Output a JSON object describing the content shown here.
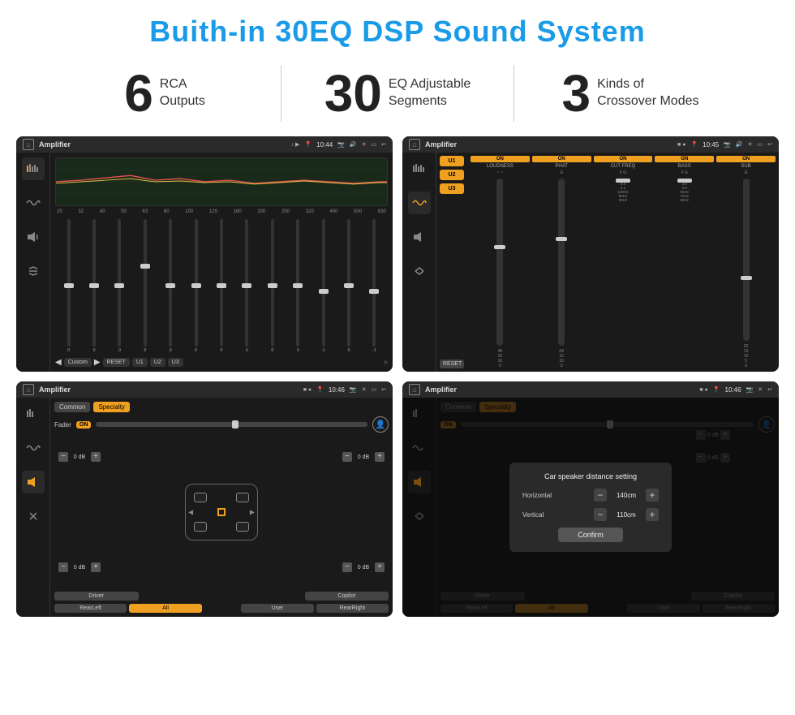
{
  "page": {
    "title": "Buith-in 30EQ DSP Sound System"
  },
  "stats": [
    {
      "number": "6",
      "label": "RCA\nOutputs"
    },
    {
      "number": "30",
      "label": "EQ Adjustable\nSegments"
    },
    {
      "number": "3",
      "label": "Kinds of\nCrossover Modes"
    }
  ],
  "screens": [
    {
      "id": "screen1",
      "title": "Amplifier",
      "time": "10:44",
      "type": "eq"
    },
    {
      "id": "screen2",
      "title": "Amplifier",
      "time": "10:45",
      "type": "crossover"
    },
    {
      "id": "screen3",
      "title": "Amplifier",
      "time": "10:46",
      "type": "fader"
    },
    {
      "id": "screen4",
      "title": "Amplifier",
      "time": "10:46",
      "type": "distance"
    }
  ],
  "eq": {
    "freq_labels": [
      "25",
      "32",
      "40",
      "50",
      "63",
      "80",
      "100",
      "125",
      "160",
      "200",
      "250",
      "320",
      "400",
      "500",
      "630"
    ],
    "slider_values": [
      "0",
      "0",
      "0",
      "5",
      "0",
      "0",
      "0",
      "0",
      "0",
      "0",
      "-1",
      "0",
      "-1"
    ],
    "preset_label": "Custom",
    "buttons": [
      "RESET",
      "U1",
      "U2",
      "U3"
    ]
  },
  "crossover": {
    "presets": [
      "U1",
      "U2",
      "U3"
    ],
    "channels": [
      {
        "toggle": "ON",
        "label": "LOUDNESS"
      },
      {
        "toggle": "ON",
        "label": "PHAT"
      },
      {
        "toggle": "ON",
        "label": "CUT FREQ"
      },
      {
        "toggle": "ON",
        "label": "BASS"
      },
      {
        "toggle": "ON",
        "label": "SUB"
      }
    ],
    "reset_label": "RESET"
  },
  "fader": {
    "tabs": [
      "Common",
      "Specialty"
    ],
    "active_tab": "Specialty",
    "fader_label": "Fader",
    "fader_on": "ON",
    "db_controls": [
      {
        "value": "0 dB"
      },
      {
        "value": "0 dB"
      },
      {
        "value": "0 dB"
      },
      {
        "value": "0 dB"
      }
    ],
    "bottom_btns": [
      "Driver",
      "",
      "",
      "",
      "Copilot"
    ],
    "bottom_btns2": [
      "RearLeft",
      "All",
      "",
      "User",
      "RearRight"
    ]
  },
  "distance": {
    "tabs": [
      "Common",
      "Specialty"
    ],
    "modal": {
      "title": "Car speaker distance setting",
      "horizontal_label": "Horizontal",
      "horizontal_value": "140cm",
      "vertical_label": "Vertical",
      "vertical_value": "110cm",
      "confirm_label": "Confirm"
    },
    "bottom_btns": [
      "Driver",
      "",
      "",
      "",
      "Copilot"
    ],
    "bottom_btns2": [
      "RearLeft",
      "All",
      "",
      "User",
      "RearRight"
    ]
  },
  "colors": {
    "accent": "#f0a020",
    "blue_title": "#1a9be8",
    "dark_bg": "#1a1a1a"
  }
}
